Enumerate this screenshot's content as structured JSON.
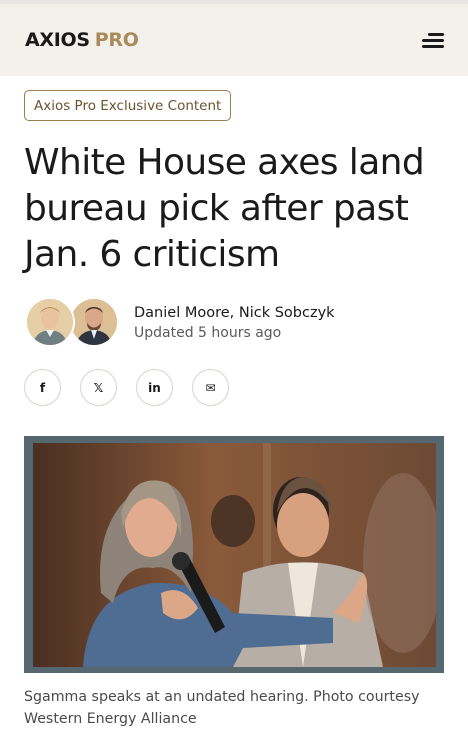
{
  "header": {
    "logo_main": "AXIOS",
    "logo_sub": "PRO",
    "menu_icon": "hamburger-menu-icon"
  },
  "colors": {
    "header_bg": "#f4f1ec",
    "accent_gold": "#a98a5c",
    "badge_text": "#6b5330",
    "photo_frame": "#566770"
  },
  "article": {
    "badge": "Axios Pro Exclusive Content",
    "headline": "White House axes land bureau pick after past Jan. 6 criticism",
    "authors": "Daniel Moore, Nick Sobczyk",
    "updated": "Updated 5 hours ago",
    "caption": "Sgamma speaks at an undated hearing. Photo courtesy Western Energy Alliance"
  },
  "share": [
    {
      "name": "facebook",
      "icon": "facebook-icon",
      "glyph": "f"
    },
    {
      "name": "x",
      "icon": "x-icon",
      "glyph": "𝕏"
    },
    {
      "name": "linkedin",
      "icon": "linkedin-icon",
      "glyph": "in"
    },
    {
      "name": "email",
      "icon": "email-icon",
      "glyph": "✉"
    }
  ]
}
